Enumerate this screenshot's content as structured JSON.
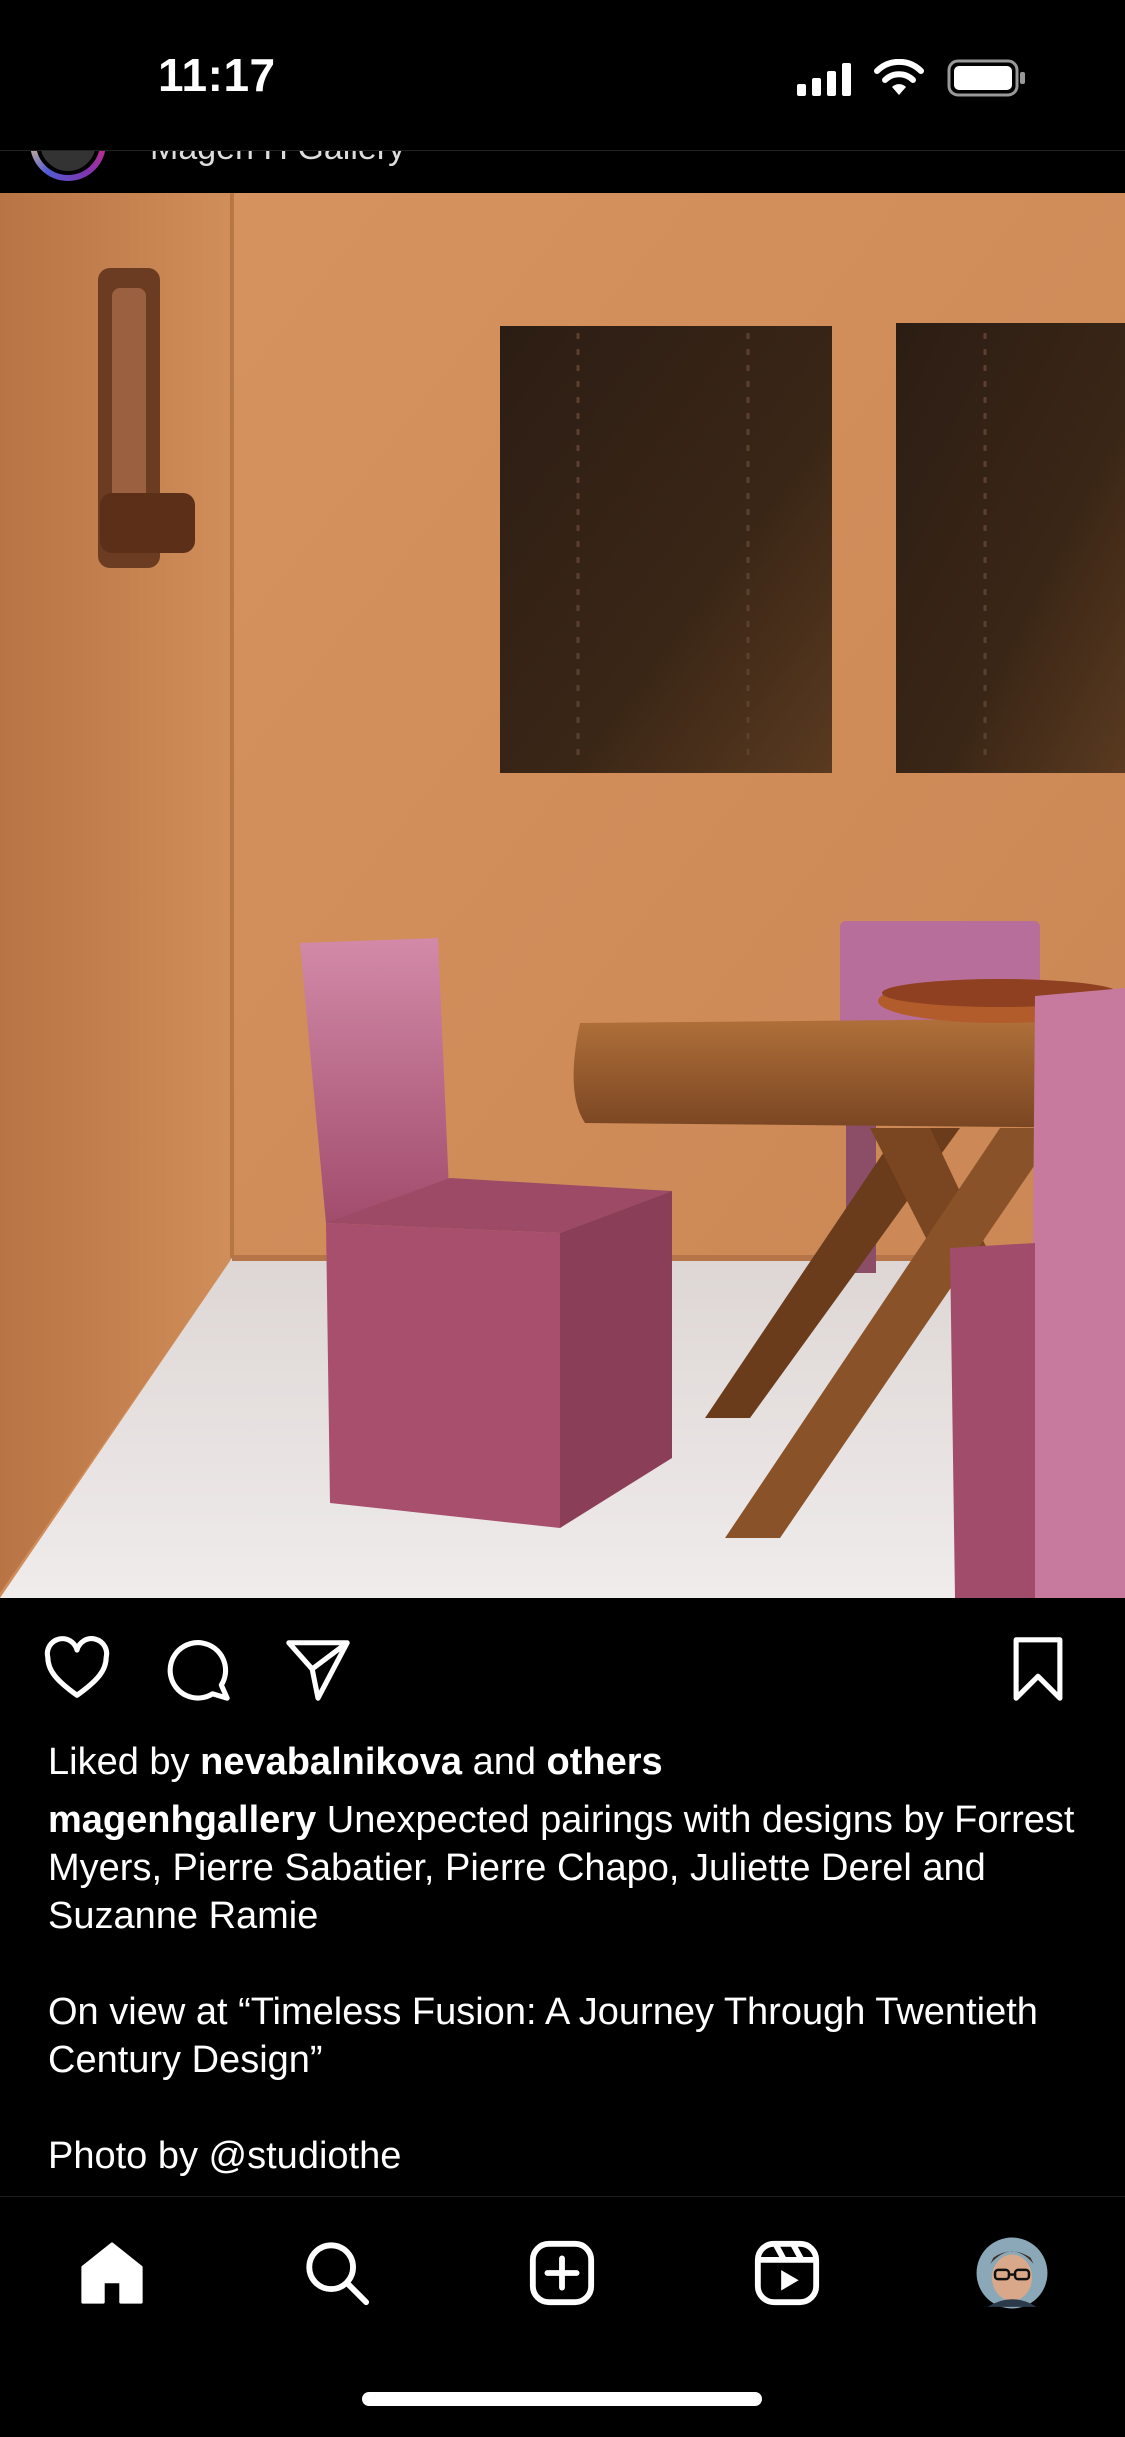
{
  "status_bar": {
    "time": "11:17",
    "icons": [
      "signal-icon",
      "wifi-icon",
      "battery-icon"
    ]
  },
  "post": {
    "header_username": "Magen H Gallery",
    "image_alt": "Gallery interior with pink metal chairs, wooden table and dark wall panels"
  },
  "actions": {
    "icons": [
      "heart-icon",
      "comment-icon",
      "share-icon",
      "bookmark-icon"
    ]
  },
  "likes": {
    "prefix": "Liked by",
    "user": "nevabalnikova",
    "middle": "and",
    "others": "others"
  },
  "caption": {
    "username": "magenhgallery",
    "text": "Unexpected pairings with designs by Forrest Myers, Pierre Sabatier, Pierre Chapo, Juliette Derel and Suzanne Ramie",
    "paragraph2": "On view at “Timeless Fusion: A Journey Through Twentieth Century Design”",
    "paragraph3": "Photo by @studiothe"
  },
  "bottom_nav": {
    "items": [
      "home-icon",
      "search-icon",
      "create-icon",
      "reels-icon",
      "profile-avatar"
    ]
  },
  "colors": {
    "background": "#000000",
    "text": "#ffffff",
    "wall": "#c98a58",
    "chair": "#b05a78"
  }
}
